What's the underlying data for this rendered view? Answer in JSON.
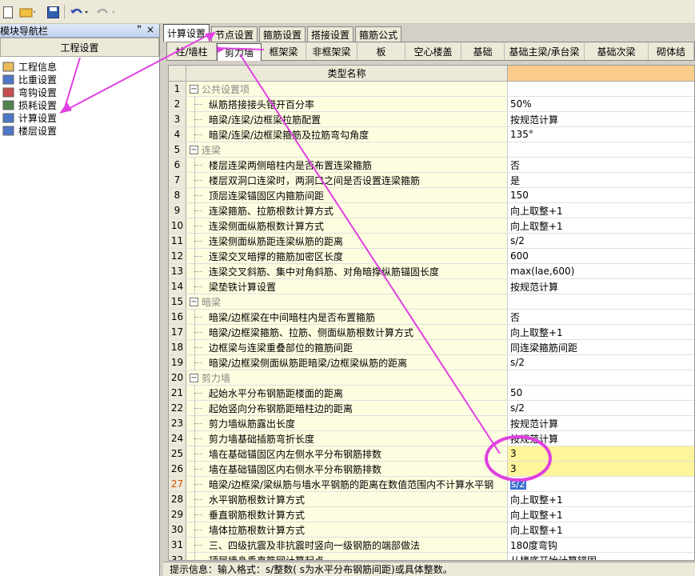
{
  "left_panel": {
    "title": "模块导航栏",
    "pin": "ꟸ",
    "close": "×",
    "section": "工程设置",
    "items": [
      {
        "label": "工程信息",
        "icon": "folder-icon",
        "color": "#e8b040"
      },
      {
        "label": "比重设置",
        "icon": "scale-icon",
        "color": "#3060c0"
      },
      {
        "label": "弯钩设置",
        "icon": "hook-icon",
        "color": "#c03030"
      },
      {
        "label": "损耗设置",
        "icon": "chart-icon",
        "color": "#307030"
      },
      {
        "label": "计算设置",
        "icon": "calc-icon",
        "color": "#3060c0"
      },
      {
        "label": "楼层设置",
        "icon": "layers-icon",
        "color": "#3060c0"
      }
    ]
  },
  "tabs_top": [
    "计算设置",
    "节点设置",
    "箍筋设置",
    "搭接设置",
    "箍筋公式"
  ],
  "tabs_sub": [
    "柱/墙柱",
    "剪力墙",
    "框架梁",
    "非框架梁",
    "板",
    "空心楼盖",
    "基础",
    "基础主梁/承台梁",
    "基础次梁",
    "砌体结"
  ],
  "grid": {
    "header_name": "类型名称",
    "rows": [
      {
        "n": "1",
        "name": "公共设置项",
        "group": true,
        "val": ""
      },
      {
        "n": "2",
        "name": "纵筋搭接接头错开百分率",
        "val": "50%"
      },
      {
        "n": "3",
        "name": "暗梁/连梁/边框梁拉筋配置",
        "val": "按规范计算"
      },
      {
        "n": "4",
        "name": "暗梁/连梁/边框梁箍筋及拉筋弯勾角度",
        "val": "135°"
      },
      {
        "n": "5",
        "name": "连梁",
        "group": true,
        "val": ""
      },
      {
        "n": "6",
        "name": "楼层连梁两侧暗柱内是否布置连梁箍筋",
        "val": "否"
      },
      {
        "n": "7",
        "name": "楼层双洞口连梁时，两洞口之间是否设置连梁箍筋",
        "val": "是"
      },
      {
        "n": "8",
        "name": "顶层连梁锚固区内箍筋间距",
        "val": "150"
      },
      {
        "n": "9",
        "name": "连梁箍筋、拉筋根数计算方式",
        "val": "向上取整+1"
      },
      {
        "n": "10",
        "name": "连梁侧面纵筋根数计算方式",
        "val": "向上取整+1"
      },
      {
        "n": "11",
        "name": "连梁侧面纵筋距连梁纵筋的距离",
        "val": "s/2"
      },
      {
        "n": "12",
        "name": "连梁交叉暗撑的箍筋加密区长度",
        "val": "600"
      },
      {
        "n": "13",
        "name": "连梁交叉斜筋、集中对角斜筋、对角暗撑纵筋锚固长度",
        "val": "max(lae,600)"
      },
      {
        "n": "14",
        "name": "梁垫铁计算设置",
        "val": "按规范计算"
      },
      {
        "n": "15",
        "name": "暗梁",
        "group": true,
        "val": ""
      },
      {
        "n": "16",
        "name": "暗梁/边框梁在中间暗柱内是否布置箍筋",
        "val": "否"
      },
      {
        "n": "17",
        "name": "暗梁/边框梁箍筋、拉筋、侧面纵筋根数计算方式",
        "val": "向上取整+1"
      },
      {
        "n": "18",
        "name": "边框梁与连梁重叠部位的箍筋间距",
        "val": "同连梁箍筋间距"
      },
      {
        "n": "19",
        "name": "暗梁/边框梁侧面纵筋距暗梁/边框梁纵筋的距离",
        "val": "s/2"
      },
      {
        "n": "20",
        "name": "剪力墙",
        "group": true,
        "val": ""
      },
      {
        "n": "21",
        "name": "起始水平分布钢筋距楼面的距离",
        "val": "50"
      },
      {
        "n": "22",
        "name": "起始竖向分布钢筋距暗柱边的距离",
        "val": "s/2"
      },
      {
        "n": "23",
        "name": "剪力墙纵筋露出长度",
        "val": "按规范计算"
      },
      {
        "n": "24",
        "name": "剪力墙基础插筋弯折长度",
        "val": "按规范计算"
      },
      {
        "n": "25",
        "name": "墙在基础锚固区内左侧水平分布钢筋排数",
        "val": "3",
        "hl": true
      },
      {
        "n": "26",
        "name": "墙在基础锚固区内右侧水平分布钢筋排数",
        "val": "3",
        "hl": true
      },
      {
        "n": "27",
        "name": "暗梁/边框梁/梁纵筋与墙水平钢筋的距离在数值范围内不计算水平钢",
        "val": "s/2",
        "sel": true
      },
      {
        "n": "28",
        "name": "水平钢筋根数计算方式",
        "val": "向上取整+1"
      },
      {
        "n": "29",
        "name": "垂直钢筋根数计算方式",
        "val": "向上取整+1"
      },
      {
        "n": "30",
        "name": "墙体拉筋根数计算方式",
        "val": "向上取整+1"
      },
      {
        "n": "31",
        "name": "三、四级抗震及非抗震时竖向一级钢筋的端部做法",
        "val": "180度弯钩"
      },
      {
        "n": "32",
        "name": "顶层墙身垂直筋网计算起点",
        "val": "从楼底开始计算锚固"
      }
    ]
  },
  "status": "提示信息：输入格式：s/整数( s为水平分布钢筋间距)或具体整数。",
  "annotation_color": "#e040e0"
}
